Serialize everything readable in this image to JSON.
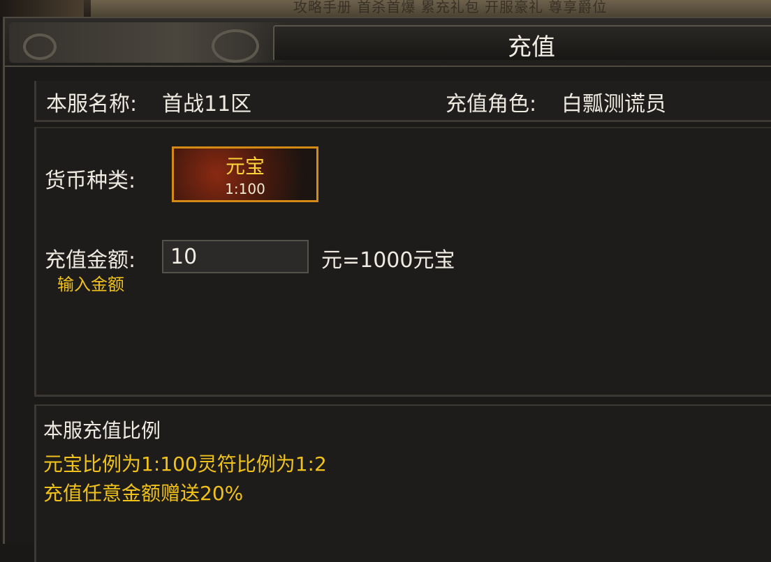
{
  "background_menu": {
    "items_text": "攻略手册  首杀首爆  累充礼包  开服豪礼  尊享爵位"
  },
  "window": {
    "title": "充值"
  },
  "info": {
    "server_label": "本服名称:",
    "server_name": "首战11区",
    "role_label": "充值角色:",
    "role_name": "白瓢测谎员"
  },
  "currency": {
    "label": "货币种类:",
    "selected": {
      "name": "元宝",
      "ratio": "1:100"
    }
  },
  "amount": {
    "label": "充值金额:",
    "value": "10",
    "hint": "输入金额",
    "conversion": "元=1000元宝"
  },
  "notes": {
    "title": "本服充值比例",
    "lines": [
      "元宝比例为1:100灵符比例为1:2",
      "充值任意金额赠送20%"
    ]
  },
  "colors": {
    "accent_gold": "#f0c21a",
    "selected_border": "#d68a16",
    "panel_bg": "#1d1c1a"
  }
}
